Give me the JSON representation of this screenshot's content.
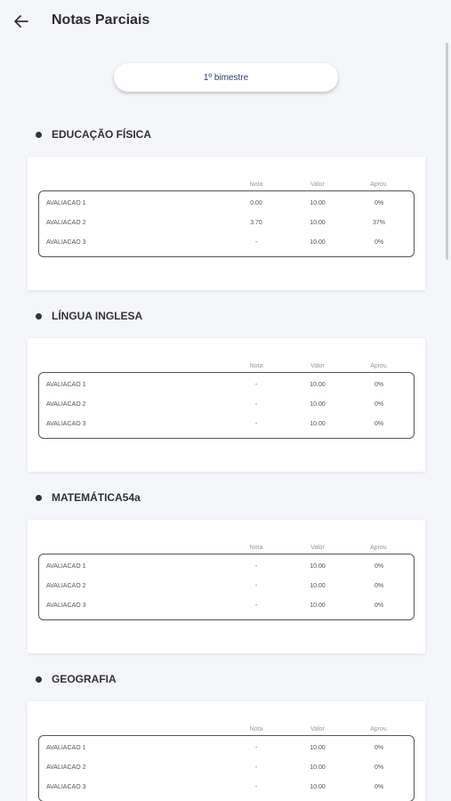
{
  "header": {
    "title": "Notas Parciais"
  },
  "period": {
    "label": "1º bimestre"
  },
  "columns": {
    "nota": "Nota",
    "valor": "Valor",
    "aprov": "Aprov."
  },
  "subjects": [
    {
      "name": "EDUCAÇÃO FÍSICA",
      "rows": [
        {
          "name": "AVALIACAO 1",
          "nota": "0.00",
          "valor": "10.00",
          "aprov": "0%"
        },
        {
          "name": "AVALIACAO 2",
          "nota": "3.70",
          "valor": "10.00",
          "aprov": "37%"
        },
        {
          "name": "AVALIACAO 3",
          "nota": "-",
          "valor": "10.00",
          "aprov": "0%"
        }
      ]
    },
    {
      "name": "LÍNGUA INGLESA",
      "rows": [
        {
          "name": "AVALIACAO 1",
          "nota": "-",
          "valor": "10.00",
          "aprov": "0%"
        },
        {
          "name": "AVALIACAO 2",
          "nota": "-",
          "valor": "10.00",
          "aprov": "0%"
        },
        {
          "name": "AVALIACAO 3",
          "nota": "-",
          "valor": "10.00",
          "aprov": "0%"
        }
      ]
    },
    {
      "name": "MATEMÁTICA54a",
      "rows": [
        {
          "name": "AVALIACAO 1",
          "nota": "-",
          "valor": "10.00",
          "aprov": "0%"
        },
        {
          "name": "AVALIACAO 2",
          "nota": "-",
          "valor": "10.00",
          "aprov": "0%"
        },
        {
          "name": "AVALIACAO 3",
          "nota": "-",
          "valor": "10.00",
          "aprov": "0%"
        }
      ]
    },
    {
      "name": "GEOGRAFIA",
      "rows": [
        {
          "name": "AVALIACAO 1",
          "nota": "-",
          "valor": "10.00",
          "aprov": "0%"
        },
        {
          "name": "AVALIACAO 2",
          "nota": "-",
          "valor": "10.00",
          "aprov": "0%"
        },
        {
          "name": "AVALIACAO 3",
          "nota": "-",
          "valor": "10.00",
          "aprov": "0%"
        }
      ]
    }
  ]
}
